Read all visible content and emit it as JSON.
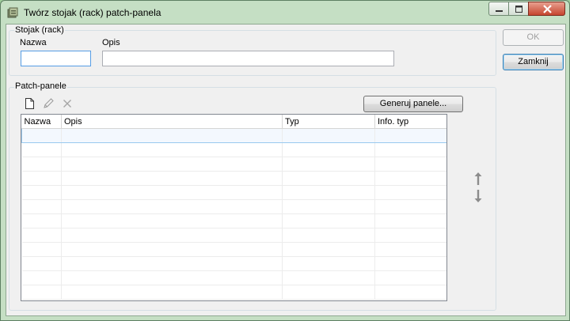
{
  "window": {
    "title": "Twórz stojak (rack) patch-panela"
  },
  "rack_group": {
    "legend": "Stojak (rack)",
    "name_label": "Nazwa",
    "name_value": "",
    "desc_label": "Opis",
    "desc_value": ""
  },
  "patch_group": {
    "legend": "Patch-panele",
    "generate_button": "Generuj panele...",
    "toolbar": [
      "new-icon",
      "edit-icon",
      "delete-icon"
    ],
    "columns": [
      "Nazwa",
      "Opis",
      "Typ",
      "Info. typ"
    ],
    "rows": [
      [
        "",
        "",
        "",
        "",
        ""
      ],
      [
        "",
        "",
        "",
        "",
        ""
      ],
      [
        "",
        "",
        "",
        "",
        ""
      ],
      [
        "",
        "",
        "",
        "",
        ""
      ],
      [
        "",
        "",
        "",
        "",
        ""
      ],
      [
        "",
        "",
        "",
        "",
        ""
      ],
      [
        "",
        "",
        "",
        "",
        ""
      ],
      [
        "",
        "",
        "",
        "",
        ""
      ],
      [
        "",
        "",
        "",
        "",
        ""
      ],
      [
        "",
        "",
        "",
        "",
        ""
      ],
      [
        "",
        "",
        "",
        "",
        ""
      ],
      [
        "",
        "",
        "",
        "",
        ""
      ]
    ]
  },
  "buttons": {
    "ok": "OK",
    "close": "Zamknij"
  },
  "colors": {
    "accent": "#569de5",
    "selection": "#f3f8fe",
    "close_button": "#c6452f"
  }
}
